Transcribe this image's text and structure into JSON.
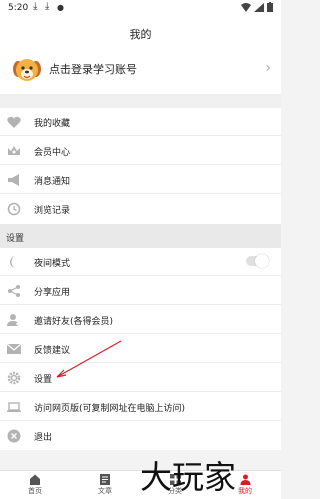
{
  "status_bar": {
    "time": "5:20"
  },
  "header": {
    "title": "我的"
  },
  "login": {
    "text": "点击登录学习账号",
    "chevron": "›"
  },
  "menu": [
    {
      "label": "我的收藏",
      "icon": "heart-icon"
    },
    {
      "label": "会员中心",
      "icon": "crown-icon"
    },
    {
      "label": "消息通知",
      "icon": "megaphone-icon"
    },
    {
      "label": "浏览记录",
      "icon": "history-icon"
    }
  ],
  "settings_section": {
    "title": "设置"
  },
  "settings": [
    {
      "label": "夜间模式",
      "icon": "moon-icon",
      "toggle": false
    },
    {
      "label": "分享应用",
      "icon": "share-icon"
    },
    {
      "label": "邀请好友(各得会员)",
      "icon": "add-person-icon"
    },
    {
      "label": "反馈建议",
      "icon": "mail-icon"
    },
    {
      "label": "设置",
      "icon": "gear-icon"
    },
    {
      "label": "访问网页版(可复制网址在电脑上访问)",
      "icon": "laptop-icon"
    },
    {
      "label": "退出",
      "icon": "close-circle-icon"
    }
  ],
  "tabbar": {
    "tabs": [
      {
        "label": "首页",
        "icon": "home-icon"
      },
      {
        "label": "文章",
        "icon": "article-icon"
      },
      {
        "label": "分类",
        "icon": "grid-icon"
      },
      {
        "label": "我的",
        "icon": "person-icon"
      }
    ]
  },
  "watermark": {
    "text": "大玩家"
  },
  "colors": {
    "icon_gray": "#b3b3b3",
    "accent": "#d91f26"
  }
}
